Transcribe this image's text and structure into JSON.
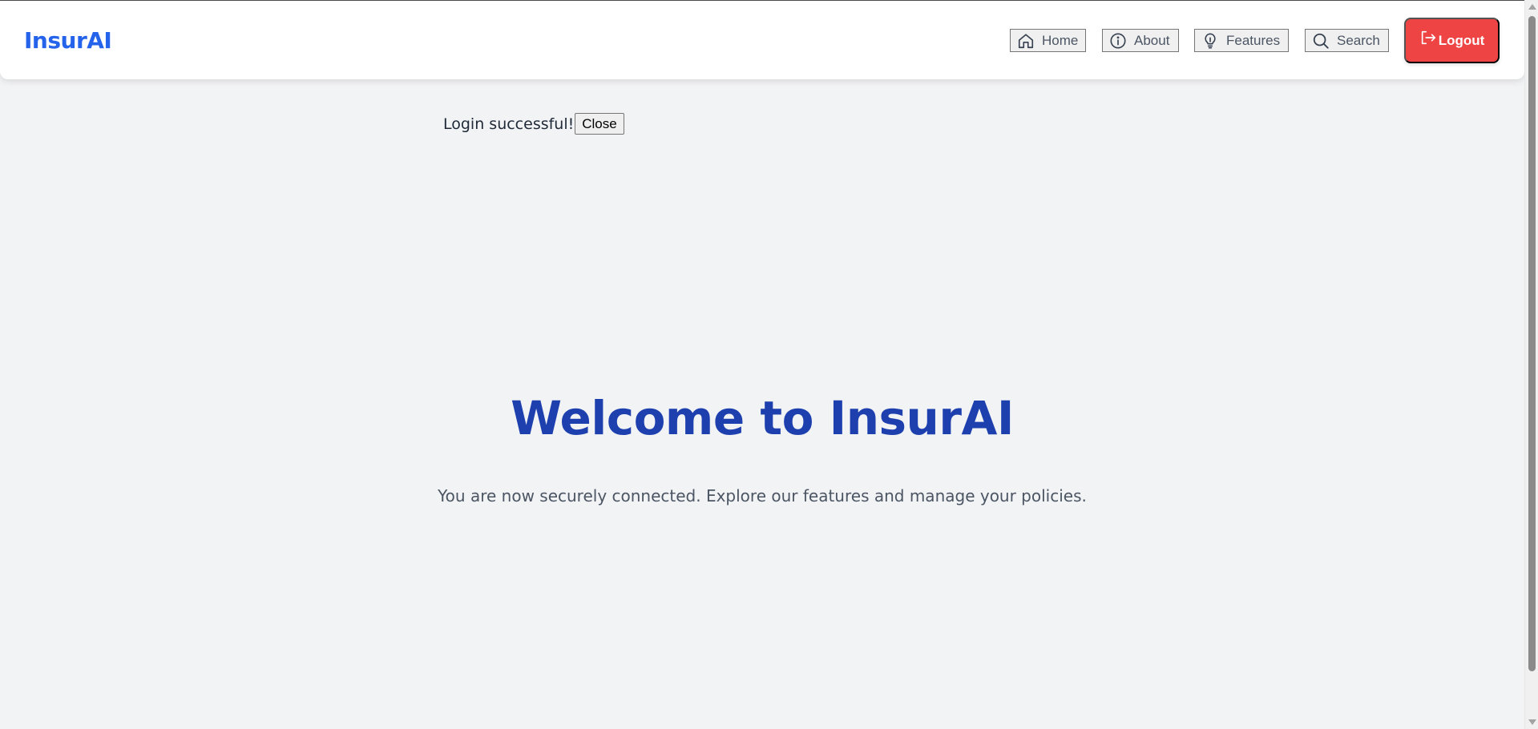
{
  "app": {
    "brand": "InsurAI"
  },
  "nav": {
    "items": [
      {
        "label": "Home",
        "icon": "home-icon"
      },
      {
        "label": "About",
        "icon": "info-icon"
      },
      {
        "label": "Features",
        "icon": "lightbulb-icon"
      },
      {
        "label": "Search",
        "icon": "search-icon"
      }
    ],
    "logout_label": "Logout",
    "logout_icon": "logout-icon"
  },
  "flash": {
    "message": "Login successful!",
    "close_label": "Close"
  },
  "hero": {
    "title": "Welcome to InsurAI",
    "subtitle": "You are now securely connected. Explore our features and manage your policies."
  },
  "colors": {
    "brand": "#2563eb",
    "hero_title": "#1e40af",
    "logout": "#ef4444",
    "background": "#f2f3f5"
  }
}
